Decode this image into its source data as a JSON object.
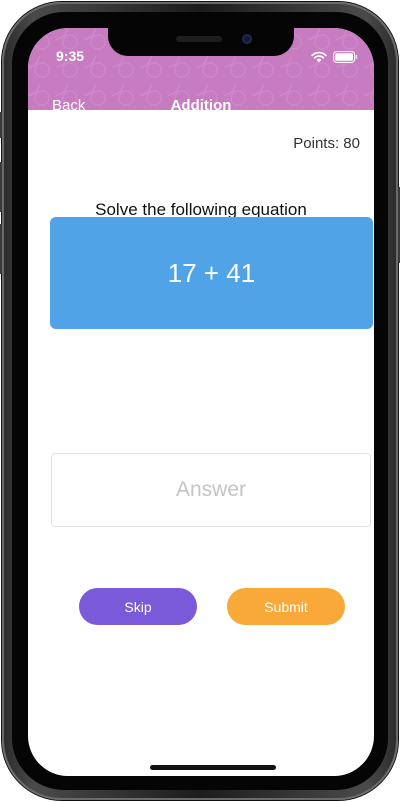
{
  "status_bar": {
    "time": "9:35",
    "icons": [
      "wifi-icon",
      "battery-icon"
    ]
  },
  "nav": {
    "back_label": "Back",
    "title": "Addition"
  },
  "score": {
    "points_text": "Points: 80"
  },
  "question": {
    "prompt": "Solve the following equation",
    "equation": "17 + 41"
  },
  "answer": {
    "value": "",
    "placeholder": "Answer"
  },
  "actions": {
    "skip_label": "Skip",
    "submit_label": "Submit"
  },
  "colors": {
    "header": "#c77cc1",
    "equation_card": "#4fa3e6",
    "skip_button": "#7b5ad9",
    "submit_button": "#f8a93a"
  }
}
